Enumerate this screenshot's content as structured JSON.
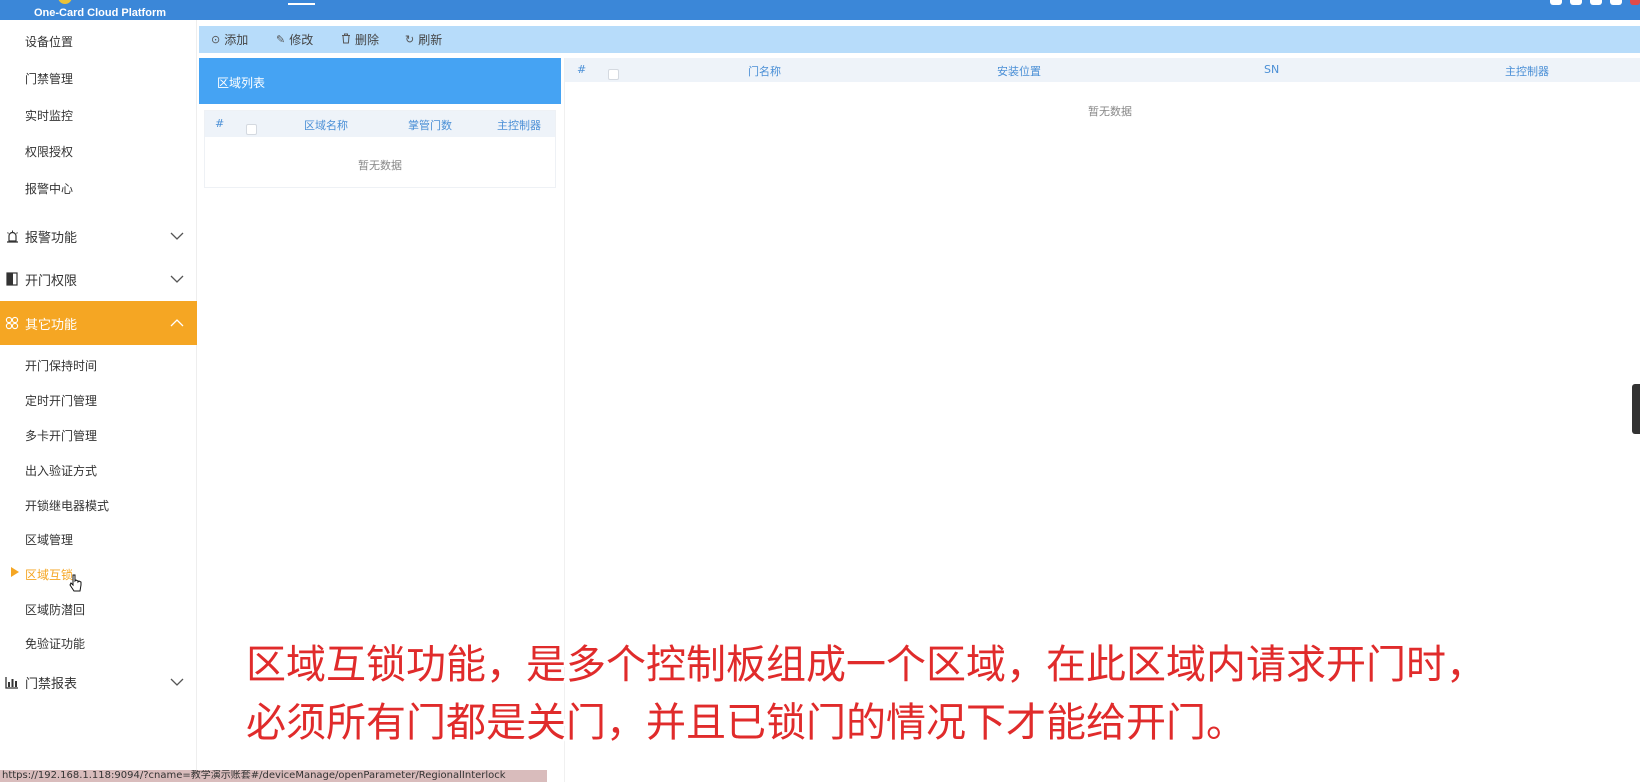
{
  "brand": {
    "name": "One-Card Cloud Platform"
  },
  "sidebar": {
    "top_items": [
      "设备位置",
      "门禁管理",
      "实时监控",
      "权限授权",
      "报警中心"
    ],
    "groups": [
      {
        "label": "报警功能",
        "icon": "alarm-icon",
        "expanded": false
      },
      {
        "label": "开门权限",
        "icon": "door-icon",
        "expanded": false
      },
      {
        "label": "其它功能",
        "icon": "settings-cluster-icon",
        "expanded": true,
        "active": true
      },
      {
        "label": "门禁报表",
        "icon": "bar-chart-icon",
        "expanded": false
      }
    ],
    "sub_items": [
      "开门保持时间",
      "定时开门管理",
      "多卡开门管理",
      "出入验证方式",
      "开锁继电器模式",
      "区域管理",
      "区域互锁",
      "区域防潜回",
      "免验证功能"
    ],
    "current_item": "区域互锁",
    "active_color": "#f5a623"
  },
  "toolbar": {
    "add_label": "添加",
    "edit_label": "修改",
    "delete_label": "删除",
    "refresh_label": "刷新"
  },
  "region_list": {
    "title": "区域列表",
    "columns": [
      "#",
      "区域名称",
      "掌管门数",
      "主控制器"
    ],
    "empty_text": "暂无数据"
  },
  "door_table": {
    "columns": [
      "#",
      "门名称",
      "安装位置",
      "SN",
      "主控制器"
    ],
    "empty_text": "暂无数据"
  },
  "caption": {
    "line1": "区域互锁功能，是多个控制板组成一个区域，在此区域内请求开门时，",
    "line2": "必须所有门都是关门，并且已锁门的情况下才能给开门。",
    "color": "#e02b2b"
  },
  "status_url": "https://192.168.1.118:9094/?cname=教学演示账套#/deviceManage/openParameter/RegionalInterlock",
  "colors": {
    "topbar": "#3b87d8",
    "toolbar": "#b7dcfa",
    "panel_header": "#45a3f3"
  }
}
